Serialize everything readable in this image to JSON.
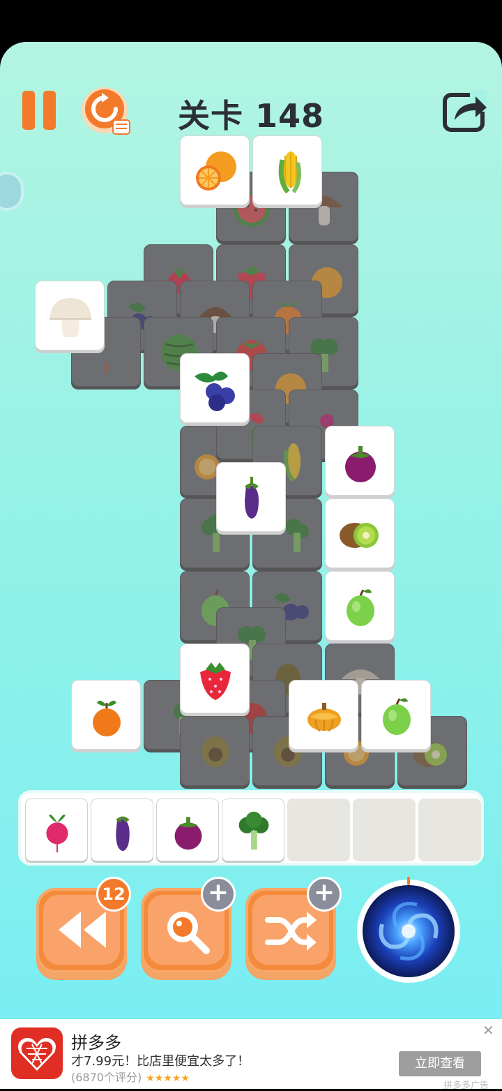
{
  "header": {
    "level_title": "关卡 148",
    "buttons": [
      "pause",
      "restart",
      "share"
    ]
  },
  "board": {
    "top_tiles": [
      "orange",
      "corn",
      "mushroom",
      "blueberry",
      "mangosteen",
      "eggplant",
      "kiwi",
      "guava",
      "strawberry",
      "tangerine",
      "pumpkin",
      "guava"
    ],
    "covered_tiles": [
      "watermelon",
      "mushroom",
      "radish",
      "strawberry",
      "orange",
      "blueberry",
      "mushroom",
      "tangerine",
      "watermelon",
      "tomato",
      "broccoli",
      "orange",
      "radish",
      "orange",
      "corn",
      "broccoli",
      "broccoli",
      "guava",
      "blueberry",
      "broccoli",
      "avocado",
      "mushroom",
      "broccoli",
      "tomato",
      "avocado",
      "avocado",
      "orange",
      "kiwi"
    ]
  },
  "tray": {
    "slots": [
      "radish",
      "eggplant",
      "mangosteen",
      "broccoli",
      "",
      "",
      ""
    ]
  },
  "tools": {
    "undo_count": "12",
    "magnifier_badge": "+",
    "shuffle_badge": "+"
  },
  "ad": {
    "app_name": "拼多多",
    "tagline": "才7.99元！比店里便宜太多了！",
    "rating": "(6870个评分)",
    "stars": "★★★★★",
    "cta": "立即查看",
    "close": "✕",
    "source": "拼多多广告",
    "brand_color": "#e02e24"
  },
  "colors": {
    "accent_orange": "#f37a2a",
    "title_text": "#2b2f33"
  }
}
